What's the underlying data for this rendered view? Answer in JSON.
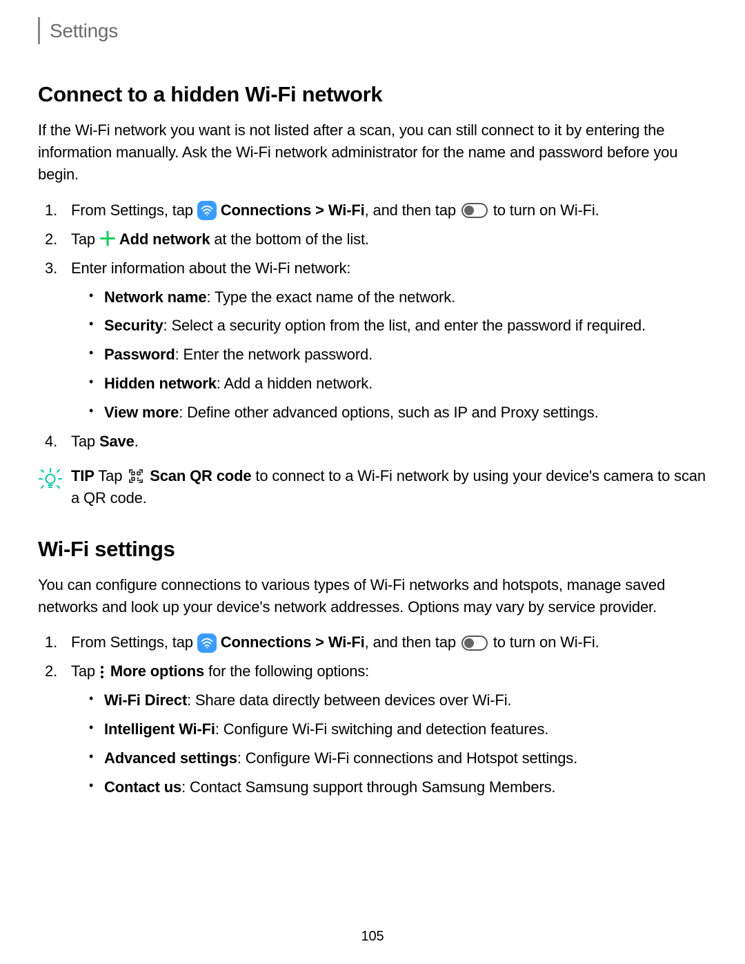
{
  "header": {
    "title": "Settings"
  },
  "section1": {
    "title": "Connect to a hidden Wi-Fi network",
    "intro": "If the Wi-Fi network you want is not listed after a scan, you can still connect to it by entering the information manually. Ask the Wi-Fi network administrator for the name and password before you begin.",
    "step1_prefix": "From Settings, tap ",
    "connections_label": "Connections",
    "wifi_path": " > Wi-Fi",
    "step1_mid": ", and then tap ",
    "step1_suffix": " to turn on Wi-Fi.",
    "step2_prefix": "Tap ",
    "add_network_label": " Add network",
    "step2_suffix": " at the bottom of the list.",
    "step3": "Enter information about the Wi-Fi network:",
    "sub1_label": "Network name",
    "sub1_text": ": Type the exact name of the network.",
    "sub2_label": "Security",
    "sub2_text": ": Select a security option from the list, and enter the password if required.",
    "sub3_label": "Password",
    "sub3_text": ": Enter the network password.",
    "sub4_label": "Hidden network",
    "sub4_text": ": Add a hidden network.",
    "sub5_label": "View more",
    "sub5_text": ": Define other advanced options, such as IP and Proxy settings.",
    "step4_prefix": "Tap ",
    "save_label": "Save",
    "step4_suffix": "."
  },
  "tip": {
    "label": "TIP",
    "prefix": "  Tap ",
    "scan_label": " Scan QR code",
    "suffix": " to connect to a Wi-Fi network by using your device's camera to scan a QR code."
  },
  "section2": {
    "title": "Wi-Fi settings",
    "intro": "You can configure connections to various types of Wi-Fi networks and hotspots, manage saved networks and look up your device's network addresses. Options may vary by service provider.",
    "step1_prefix": "From Settings, tap ",
    "connections_label": "Connections",
    "wifi_path": " > Wi-Fi",
    "step1_mid": ", and then tap ",
    "step1_suffix": " to turn on Wi-Fi.",
    "step2_prefix": "Tap ",
    "more_options_label": " More options",
    "step2_suffix": " for the following options:",
    "sub1_label": "Wi-Fi Direct",
    "sub1_text": ": Share data directly between devices over Wi-Fi.",
    "sub2_label": "Intelligent Wi-Fi",
    "sub2_text": ": Configure Wi-Fi switching and detection features.",
    "sub3_label": "Advanced settings",
    "sub3_text": ": Configure Wi-Fi connections and Hotspot settings.",
    "sub4_label": "Contact us",
    "sub4_text": ": Contact Samsung support through Samsung Members."
  },
  "page_number": "105"
}
